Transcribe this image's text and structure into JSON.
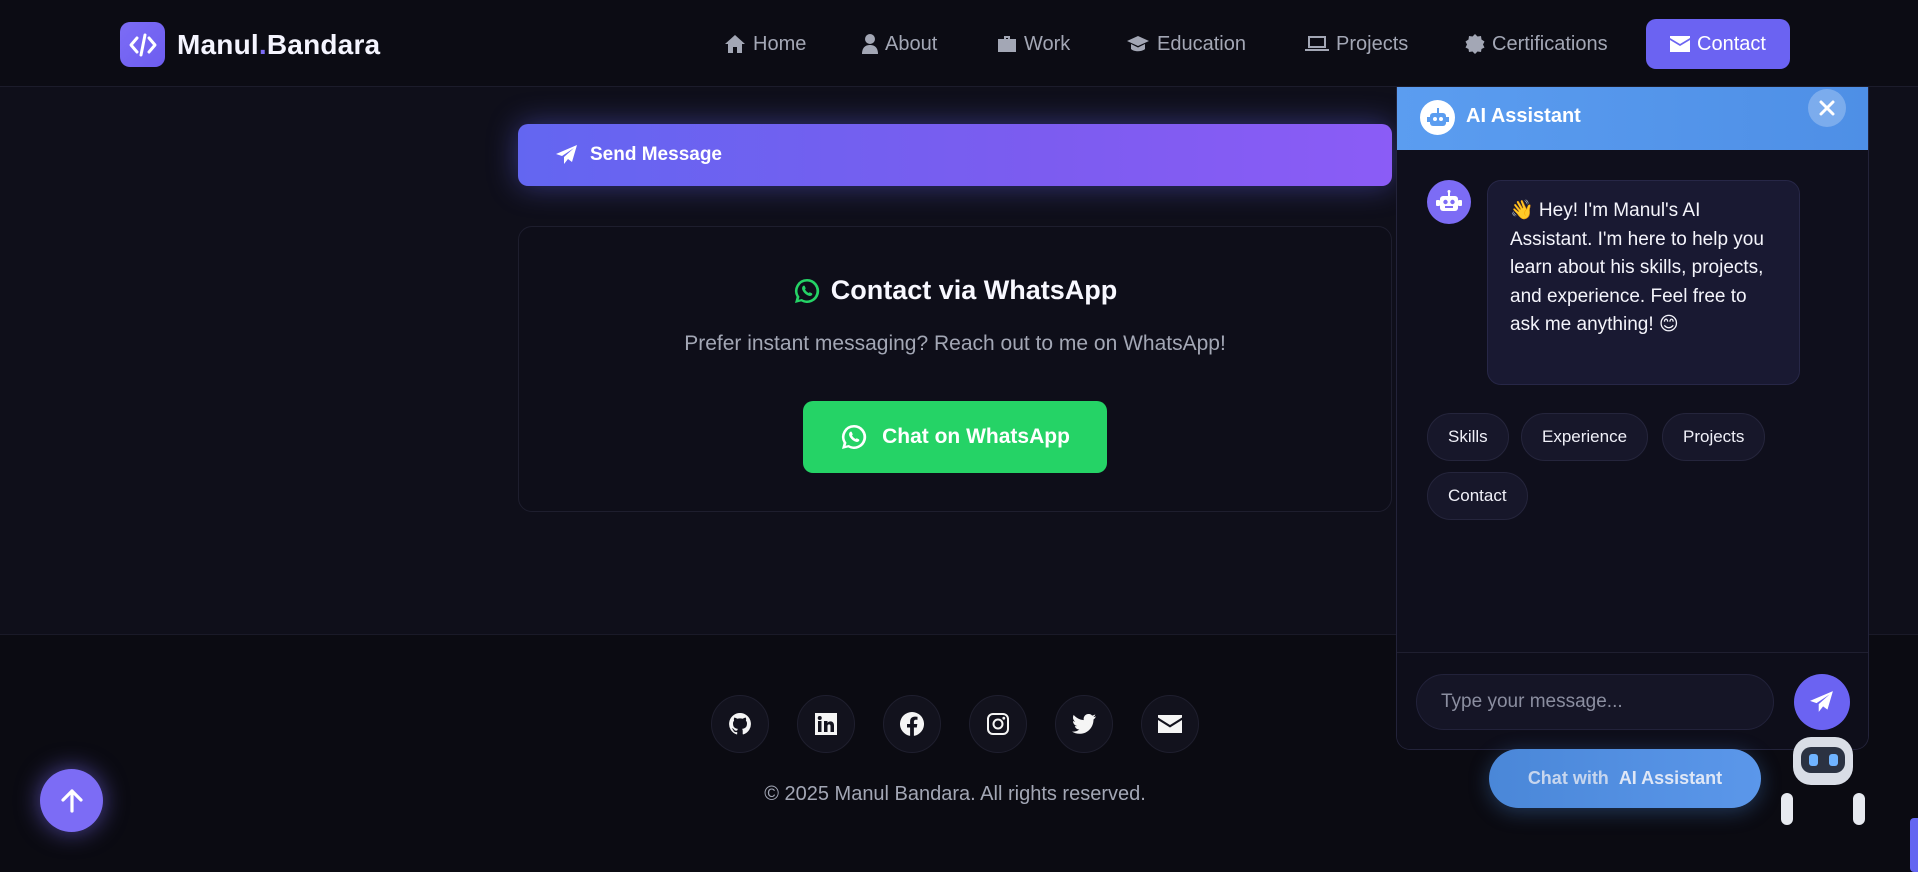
{
  "brand": {
    "name_part1": "Manul",
    "dot": ".",
    "name_part2": "Bandara"
  },
  "nav": {
    "items": [
      {
        "label": "Home",
        "icon": "home-icon"
      },
      {
        "label": "About",
        "icon": "user-icon"
      },
      {
        "label": "Work",
        "icon": "briefcase-icon"
      },
      {
        "label": "Education",
        "icon": "graduation-cap-icon"
      },
      {
        "label": "Projects",
        "icon": "laptop-code-icon"
      },
      {
        "label": "Certifications",
        "icon": "certificate-icon"
      },
      {
        "label": "Contact",
        "icon": "envelope-icon",
        "active": true
      }
    ]
  },
  "contact": {
    "send_label": "Send Message",
    "whatsapp_title": "Contact via WhatsApp",
    "whatsapp_subtitle": "Prefer instant messaging? Reach out to me on WhatsApp!",
    "whatsapp_button": "Chat on WhatsApp"
  },
  "footer": {
    "social": [
      "github-icon",
      "linkedin-icon",
      "facebook-icon",
      "instagram-icon",
      "twitter-icon",
      "envelope-icon"
    ],
    "copyright": "© 2025 Manul Bandara. All rights reserved."
  },
  "chat": {
    "title": "AI Assistant",
    "greeting": "👋 Hey! I'm Manul's AI Assistant. I'm here to help you learn about his skills, projects, and experience. Feel free to ask me anything! 😊",
    "quick_replies": [
      "Skills",
      "Experience",
      "Projects",
      "Contact"
    ],
    "input_placeholder": "Type your message..."
  },
  "launcher": {
    "prefix": "Chat with",
    "name": "AI Assistant"
  },
  "colors": {
    "accent": "#6b63f2",
    "whatsapp": "#25d366",
    "chat_header": "#5b9df0",
    "background": "#0f0f1a"
  }
}
